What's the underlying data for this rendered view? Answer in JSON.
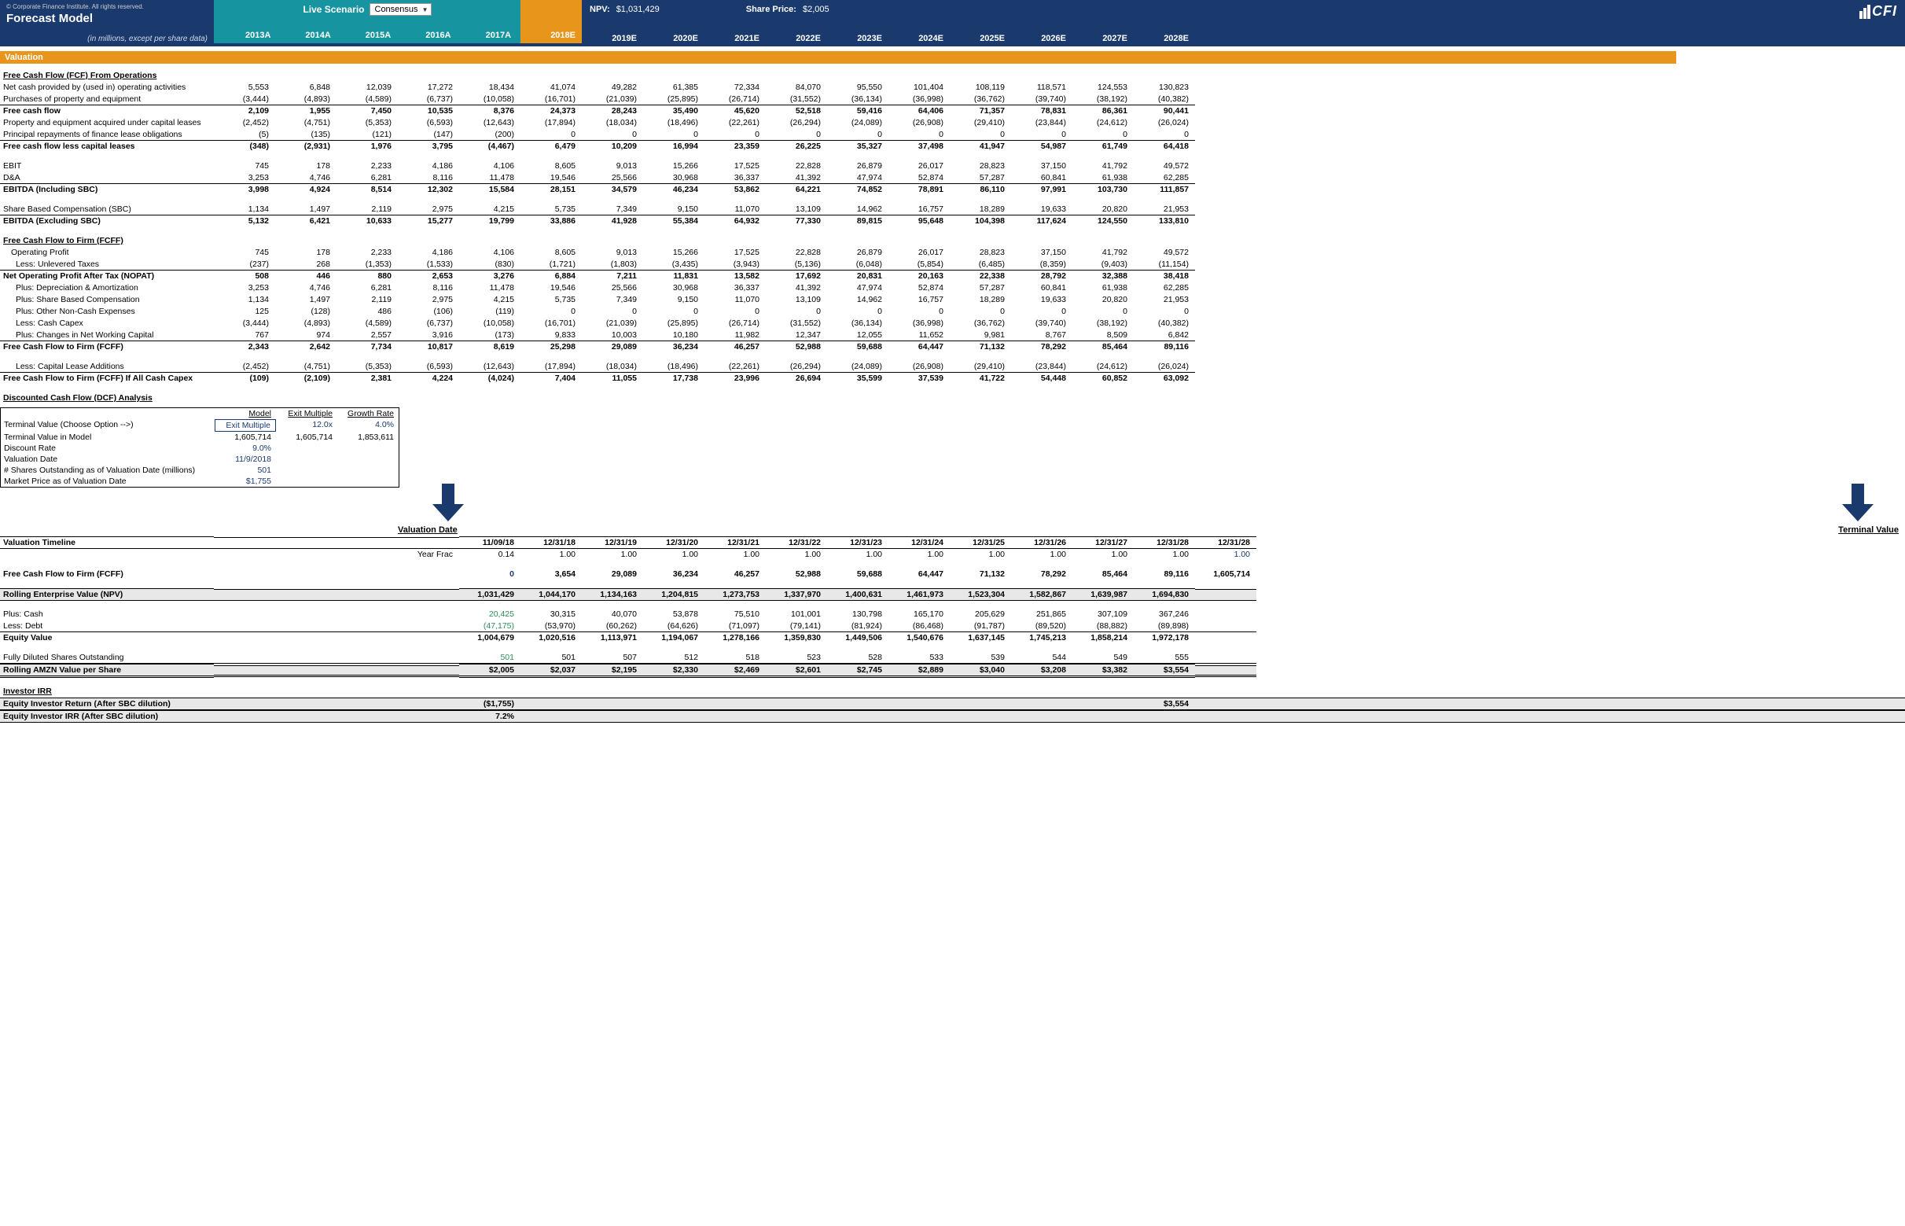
{
  "header": {
    "copyright": "© Corporate Finance Institute. All rights reserved.",
    "title": "Forecast Model",
    "subtitle": "(in millions, except per share data)",
    "scenario_label": "Live Scenario",
    "scenario_value": "Consensus",
    "npv_label": "NPV:",
    "npv_value": "$1,031,429",
    "price_label": "Share Price:",
    "price_value": "$2,005",
    "logo": "CFI"
  },
  "years": [
    "2013A",
    "2014A",
    "2015A",
    "2016A",
    "2017A",
    "2018E",
    "2019E",
    "2020E",
    "2021E",
    "2022E",
    "2023E",
    "2024E",
    "2025E",
    "2026E",
    "2027E",
    "2028E"
  ],
  "estimate_index": 5,
  "section_valuation": "Valuation",
  "fcf_ops_head": "Free Cash Flow (FCF) From Operations",
  "rows_fcf_ops": [
    {
      "label": "Net cash provided by (used in) operating activities",
      "v": [
        "5,553",
        "6,848",
        "12,039",
        "17,272",
        "18,434",
        "41,074",
        "49,282",
        "61,385",
        "72,334",
        "84,070",
        "95,550",
        "101,404",
        "108,119",
        "118,571",
        "124,553",
        "130,823"
      ]
    },
    {
      "label": "Purchases of property and equipment",
      "v": [
        "(3,444)",
        "(4,893)",
        "(4,589)",
        "(6,737)",
        "(10,058)",
        "(16,701)",
        "(21,039)",
        "(25,895)",
        "(26,714)",
        "(31,552)",
        "(36,134)",
        "(36,998)",
        "(36,762)",
        "(39,740)",
        "(38,192)",
        "(40,382)"
      ],
      "underline": true
    },
    {
      "label": "Free cash flow",
      "bold": true,
      "v": [
        "2,109",
        "1,955",
        "7,450",
        "10,535",
        "8,376",
        "24,373",
        "28,243",
        "35,490",
        "45,620",
        "52,518",
        "59,416",
        "64,406",
        "71,357",
        "78,831",
        "86,361",
        "90,441"
      ]
    },
    {
      "label": "Property and equipment acquired under capital leases",
      "v": [
        "(2,452)",
        "(4,751)",
        "(5,353)",
        "(6,593)",
        "(12,643)",
        "(17,894)",
        "(18,034)",
        "(18,496)",
        "(22,261)",
        "(26,294)",
        "(24,089)",
        "(26,908)",
        "(29,410)",
        "(23,844)",
        "(24,612)",
        "(26,024)"
      ]
    },
    {
      "label": "Principal repayments of finance lease obligations",
      "v": [
        "(5)",
        "(135)",
        "(121)",
        "(147)",
        "(200)",
        "0",
        "0",
        "0",
        "0",
        "0",
        "0",
        "0",
        "0",
        "0",
        "0",
        "0"
      ],
      "underline": true
    },
    {
      "label": "Free cash flow less capital leases",
      "bold": true,
      "v": [
        "(348)",
        "(2,931)",
        "1,976",
        "3,795",
        "(4,467)",
        "6,479",
        "10,209",
        "16,994",
        "23,359",
        "26,225",
        "35,327",
        "37,498",
        "41,947",
        "54,987",
        "61,749",
        "64,418"
      ]
    }
  ],
  "rows_ebitda": [
    {
      "label": "EBIT",
      "v": [
        "745",
        "178",
        "2,233",
        "4,186",
        "4,106",
        "8,605",
        "9,013",
        "15,266",
        "17,525",
        "22,828",
        "26,879",
        "26,017",
        "28,823",
        "37,150",
        "41,792",
        "49,572"
      ]
    },
    {
      "label": "D&A",
      "v": [
        "3,253",
        "4,746",
        "6,281",
        "8,116",
        "11,478",
        "19,546",
        "25,566",
        "30,968",
        "36,337",
        "41,392",
        "47,974",
        "52,874",
        "57,287",
        "60,841",
        "61,938",
        "62,285"
      ],
      "underline": true
    },
    {
      "label": "EBITDA (Including SBC)",
      "bold": true,
      "v": [
        "3,998",
        "4,924",
        "8,514",
        "12,302",
        "15,584",
        "28,151",
        "34,579",
        "46,234",
        "53,862",
        "64,221",
        "74,852",
        "78,891",
        "86,110",
        "97,991",
        "103,730",
        "111,857"
      ]
    }
  ],
  "rows_ebitda2": [
    {
      "label": "Share Based Compensation (SBC)",
      "v": [
        "1,134",
        "1,497",
        "2,119",
        "2,975",
        "4,215",
        "5,735",
        "7,349",
        "9,150",
        "11,070",
        "13,109",
        "14,962",
        "16,757",
        "18,289",
        "19,633",
        "20,820",
        "21,953"
      ],
      "underline": true
    },
    {
      "label": "EBITDA (Excluding SBC)",
      "bold": true,
      "v": [
        "5,132",
        "6,421",
        "10,633",
        "15,277",
        "19,799",
        "33,886",
        "41,928",
        "55,384",
        "64,932",
        "77,330",
        "89,815",
        "95,648",
        "104,398",
        "117,624",
        "124,550",
        "133,810"
      ]
    }
  ],
  "fcff_head": "Free Cash Flow to Firm (FCFF)",
  "rows_fcff": [
    {
      "label": "Operating Profit",
      "indent": 1,
      "v": [
        "745",
        "178",
        "2,233",
        "4,186",
        "4,106",
        "8,605",
        "9,013",
        "15,266",
        "17,525",
        "22,828",
        "26,879",
        "26,017",
        "28,823",
        "37,150",
        "41,792",
        "49,572"
      ]
    },
    {
      "label": "Less: Unlevered Taxes",
      "indent": 2,
      "v": [
        "(237)",
        "268",
        "(1,353)",
        "(1,533)",
        "(830)",
        "(1,721)",
        "(1,803)",
        "(3,435)",
        "(3,943)",
        "(5,136)",
        "(6,048)",
        "(5,854)",
        "(6,485)",
        "(8,359)",
        "(9,403)",
        "(11,154)"
      ],
      "underline": true
    },
    {
      "label": "Net Operating Profit After Tax (NOPAT)",
      "bold": true,
      "v": [
        "508",
        "446",
        "880",
        "2,653",
        "3,276",
        "6,884",
        "7,211",
        "11,831",
        "13,582",
        "17,692",
        "20,831",
        "20,163",
        "22,338",
        "28,792",
        "32,388",
        "38,418"
      ]
    },
    {
      "label": "Plus: Depreciation & Amortization",
      "indent": 2,
      "v": [
        "3,253",
        "4,746",
        "6,281",
        "8,116",
        "11,478",
        "19,546",
        "25,566",
        "30,968",
        "36,337",
        "41,392",
        "47,974",
        "52,874",
        "57,287",
        "60,841",
        "61,938",
        "62,285"
      ]
    },
    {
      "label": "Plus: Share Based Compensation",
      "indent": 2,
      "v": [
        "1,134",
        "1,497",
        "2,119",
        "2,975",
        "4,215",
        "5,735",
        "7,349",
        "9,150",
        "11,070",
        "13,109",
        "14,962",
        "16,757",
        "18,289",
        "19,633",
        "20,820",
        "21,953"
      ]
    },
    {
      "label": "Plus: Other Non-Cash Expenses",
      "indent": 2,
      "v": [
        "125",
        "(128)",
        "486",
        "(106)",
        "(119)",
        "0",
        "0",
        "0",
        "0",
        "0",
        "0",
        "0",
        "0",
        "0",
        "0",
        "0"
      ]
    },
    {
      "label": "Less: Cash Capex",
      "indent": 2,
      "v": [
        "(3,444)",
        "(4,893)",
        "(4,589)",
        "(6,737)",
        "(10,058)",
        "(16,701)",
        "(21,039)",
        "(25,895)",
        "(26,714)",
        "(31,552)",
        "(36,134)",
        "(36,998)",
        "(36,762)",
        "(39,740)",
        "(38,192)",
        "(40,382)"
      ]
    },
    {
      "label": "Plus: Changes in Net Working Capital",
      "indent": 2,
      "v": [
        "767",
        "974",
        "2,557",
        "3,916",
        "(173)",
        "9,833",
        "10,003",
        "10,180",
        "11,982",
        "12,347",
        "12,055",
        "11,652",
        "9,981",
        "8,767",
        "8,509",
        "6,842"
      ],
      "underline": true
    },
    {
      "label": "Free Cash Flow to Firm (FCFF)",
      "bold": true,
      "v": [
        "2,343",
        "2,642",
        "7,734",
        "10,817",
        "8,619",
        "25,298",
        "29,089",
        "36,234",
        "46,257",
        "52,988",
        "59,688",
        "64,447",
        "71,132",
        "78,292",
        "85,464",
        "89,116"
      ]
    }
  ],
  "rows_fcff2": [
    {
      "label": "Less: Capital Lease Additions",
      "indent": 2,
      "v": [
        "(2,452)",
        "(4,751)",
        "(5,353)",
        "(6,593)",
        "(12,643)",
        "(17,894)",
        "(18,034)",
        "(18,496)",
        "(22,261)",
        "(26,294)",
        "(24,089)",
        "(26,908)",
        "(29,410)",
        "(23,844)",
        "(24,612)",
        "(26,024)"
      ],
      "underline": true
    },
    {
      "label": "Free Cash Flow to Firm (FCFF) If All Cash Capex",
      "bold": true,
      "v": [
        "(109)",
        "(2,109)",
        "2,381",
        "4,224",
        "(4,024)",
        "7,404",
        "11,055",
        "17,738",
        "23,996",
        "26,694",
        "35,599",
        "37,539",
        "41,722",
        "54,448",
        "60,852",
        "63,092"
      ]
    }
  ],
  "dcf_head": "Discounted Cash Flow (DCF) Analysis",
  "dcf_table": {
    "headers": [
      "Model",
      "Exit Multiple",
      "Growth Rate"
    ],
    "rows": [
      {
        "label": "Terminal Value (Choose Option -->)",
        "v": [
          "Exit Multiple",
          "12.0x",
          "4.0%"
        ],
        "boxed": 0,
        "blue": [
          1,
          2
        ]
      },
      {
        "label": "Terminal Value in Model",
        "v": [
          "1,605,714",
          "1,605,714",
          "1,853,611"
        ]
      },
      {
        "label": "Discount Rate",
        "v": [
          "9.0%",
          "",
          ""
        ],
        "blue": [
          0
        ]
      },
      {
        "label": "Valuation Date",
        "v": [
          "11/9/2018",
          "",
          ""
        ],
        "blue": [
          0
        ]
      },
      {
        "label": "# Shares Outstanding as of Valuation Date (millions)",
        "v": [
          "501",
          "",
          ""
        ],
        "blue": [
          0
        ]
      },
      {
        "label": "Market Price as of Valuation Date",
        "v": [
          "$1,755",
          "",
          ""
        ],
        "blue": [
          0
        ]
      }
    ]
  },
  "arrow_labels": {
    "valuation_date": "Valuation Date",
    "terminal_value": "Terminal Value"
  },
  "timeline": {
    "label": "Valuation Timeline",
    "dates": [
      "11/09/18",
      "12/31/18",
      "12/31/19",
      "12/31/20",
      "12/31/21",
      "12/31/22",
      "12/31/23",
      "12/31/24",
      "12/31/25",
      "12/31/26",
      "12/31/27",
      "12/31/28",
      "12/31/28"
    ],
    "frac_label": "Year Frac",
    "frac": [
      "0.14",
      "1.00",
      "1.00",
      "1.00",
      "1.00",
      "1.00",
      "1.00",
      "1.00",
      "1.00",
      "1.00",
      "1.00",
      "1.00",
      "1.00"
    ]
  },
  "rows_timeline": [
    {
      "label": "Free Cash Flow to Firm (FCFF)",
      "bold": true,
      "v": [
        "0",
        "3,654",
        "29,089",
        "36,234",
        "46,257",
        "52,988",
        "59,688",
        "64,447",
        "71,132",
        "78,292",
        "85,464",
        "89,116",
        "1,605,714"
      ],
      "first_blue": true
    },
    {
      "label": "Rolling Enterprise Value (NPV)",
      "bold": true,
      "shaded": true,
      "border": true,
      "v": [
        "1,031,429",
        "1,044,170",
        "1,134,163",
        "1,204,815",
        "1,273,753",
        "1,337,970",
        "1,400,631",
        "1,461,973",
        "1,523,304",
        "1,582,867",
        "1,639,987",
        "1,694,830",
        ""
      ]
    },
    {
      "label": "Plus: Cash",
      "v": [
        "20,425",
        "30,315",
        "40,070",
        "53,878",
        "75,510",
        "101,001",
        "130,798",
        "165,170",
        "205,629",
        "251,865",
        "307,109",
        "367,246",
        ""
      ],
      "first_green": true
    },
    {
      "label": "Less: Debt",
      "v": [
        "(47,175)",
        "(53,970)",
        "(60,262)",
        "(64,626)",
        "(71,097)",
        "(79,141)",
        "(81,924)",
        "(86,468)",
        "(91,787)",
        "(89,520)",
        "(88,882)",
        "(89,898)",
        ""
      ],
      "underline": true,
      "first_green": true
    },
    {
      "label": "Equity Value",
      "bold": true,
      "v": [
        "1,004,679",
        "1,020,516",
        "1,113,971",
        "1,194,067",
        "1,278,166",
        "1,359,830",
        "1,449,506",
        "1,540,676",
        "1,637,145",
        "1,745,213",
        "1,858,214",
        "1,972,178",
        ""
      ]
    },
    {
      "label": "Fully Diluted Shares Outstanding",
      "v": [
        "501",
        "501",
        "507",
        "512",
        "518",
        "523",
        "528",
        "533",
        "539",
        "544",
        "549",
        "555",
        ""
      ],
      "underline": true,
      "first_green": true
    },
    {
      "label": "Rolling AMZN Value per Share",
      "bold": true,
      "shaded": true,
      "border": true,
      "dbl": true,
      "v": [
        "$2,005",
        "$2,037",
        "$2,195",
        "$2,330",
        "$2,469",
        "$2,601",
        "$2,745",
        "$2,889",
        "$3,040",
        "$3,208",
        "$3,382",
        "$3,554",
        ""
      ]
    }
  ],
  "investor_irr_head": "Investor IRR",
  "investor_rows": [
    {
      "label": "Equity Investor Return (After SBC dilution)",
      "v": [
        "($1,755)",
        "",
        "",
        "",
        "",
        "",
        "",
        "",
        "",
        "",
        "",
        "$3,554",
        ""
      ]
    },
    {
      "label": "Equity Investor IRR (After SBC dilution)",
      "v": [
        "7.2%",
        "",
        "",
        "",
        "",
        "",
        "",
        "",
        "",
        "",
        "",
        "",
        ""
      ]
    }
  ]
}
